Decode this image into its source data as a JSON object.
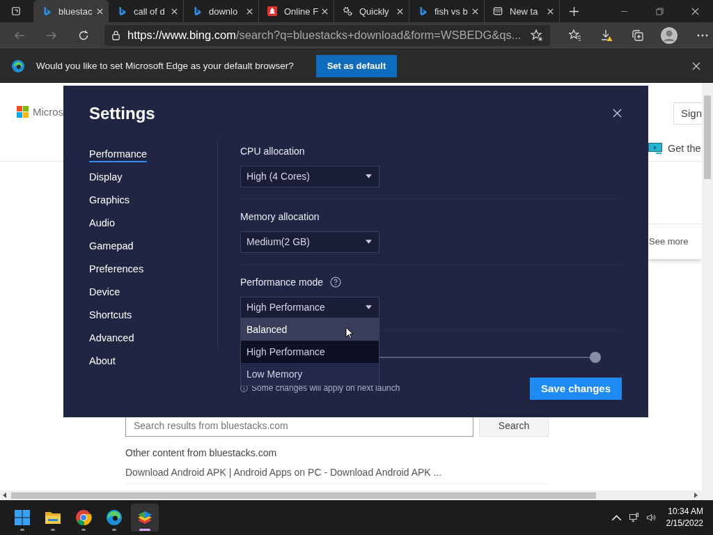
{
  "tabs": [
    {
      "title": "bluestac",
      "kind": "bing",
      "selected": true
    },
    {
      "title": "call of d",
      "kind": "bing",
      "selected": false
    },
    {
      "title": "downlo",
      "kind": "bing",
      "selected": false
    },
    {
      "title": "Online F",
      "kind": "tree",
      "selected": false
    },
    {
      "title": "Quickly",
      "kind": "gear",
      "selected": false
    },
    {
      "title": "fish vs b",
      "kind": "bing",
      "selected": false
    },
    {
      "title": "New ta",
      "kind": "page",
      "selected": false
    }
  ],
  "address_bar": {
    "host": "https://www.bing.com",
    "path": "/search?q=bluestacks+download&form=WSBEDG&qs..."
  },
  "infobar": {
    "message": "Would you like to set Microsoft Edge as your default browser?",
    "button": "Set as default"
  },
  "page": {
    "logo_text": "Micros",
    "sign_in": "Sign",
    "get_app": "Get the",
    "see_more": "See more",
    "search_placeholder": "Search results from bluestacks.com",
    "search_button": "Search",
    "other_heading": "Other content from bluestacks.com",
    "links": [
      "Download Android APK | Android Apps on PC - Download Android APK ..."
    ]
  },
  "settings": {
    "title": "Settings",
    "nav": [
      {
        "label": "Performance",
        "selected": true
      },
      {
        "label": "Display",
        "selected": false
      },
      {
        "label": "Graphics",
        "selected": false
      },
      {
        "label": "Audio",
        "selected": false
      },
      {
        "label": "Gamepad",
        "selected": false
      },
      {
        "label": "Preferences",
        "selected": false
      },
      {
        "label": "Device",
        "selected": false
      },
      {
        "label": "Shortcuts",
        "selected": false
      },
      {
        "label": "Advanced",
        "selected": false
      },
      {
        "label": "About",
        "selected": false
      }
    ],
    "sections": [
      {
        "label": "CPU allocation",
        "value": "High (4 Cores)",
        "help": false,
        "open": false
      },
      {
        "label": "Memory allocation",
        "value": "Medium(2 GB)",
        "help": false,
        "open": false
      },
      {
        "label": "Performance mode",
        "value": "High Performance",
        "help": true,
        "open": true
      }
    ],
    "options": [
      {
        "label": "Balanced",
        "selected": false,
        "hovered": true
      },
      {
        "label": "High Performance",
        "selected": true,
        "hovered": false
      },
      {
        "label": "Low Memory",
        "selected": false,
        "hovered": false
      }
    ],
    "slider": {
      "level": 1
    },
    "note": "Some changes will apply on next launch",
    "save_button": "Save changes"
  },
  "taskbar": {
    "apps": [
      {
        "kind": "start",
        "active": false
      },
      {
        "kind": "folder",
        "active": false
      },
      {
        "kind": "chrome",
        "active": false
      },
      {
        "kind": "edge",
        "active": false
      },
      {
        "kind": "stack",
        "active": true
      }
    ],
    "time": "10:34 AM",
    "date": "2/15/2022"
  }
}
